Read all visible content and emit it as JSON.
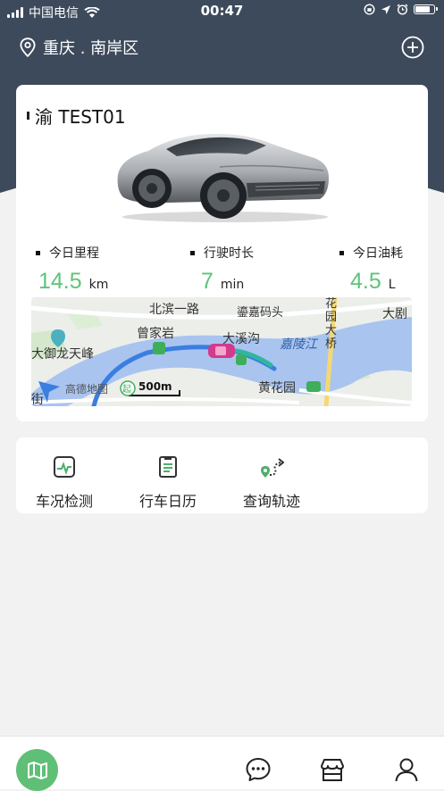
{
  "status_bar": {
    "carrier": "中国电信",
    "time": "00:47"
  },
  "location": {
    "city": "重庆 . 南岸区"
  },
  "vehicle": {
    "plate": "渝 TEST01"
  },
  "stats": [
    {
      "label": "今日里程",
      "value": "14.5",
      "unit": "km"
    },
    {
      "label": "行驶时长",
      "value": "7",
      "unit": "min"
    },
    {
      "label": "今日油耗",
      "value": "4.5",
      "unit": "L"
    }
  ],
  "map": {
    "labels": {
      "beibin_road": "北滨一路",
      "luanjia": "鎏嘉码头",
      "bridge": "花园大桥",
      "daju": "大剧",
      "zengjiayan": "曾家岩",
      "daxigou": "大溪沟",
      "jialingjiang": "嘉陵江",
      "dayu": "大御龙天峰",
      "huanghuayuan": "黄花园",
      "jie": "街",
      "amap": "高德地图",
      "start": "起",
      "scale": "500m"
    }
  },
  "functions": [
    {
      "label": "车况检测",
      "icon": "pulse-monitor-icon"
    },
    {
      "label": "行车日历",
      "icon": "clipboard-list-icon"
    },
    {
      "label": "查询轨迹",
      "icon": "route-track-icon"
    }
  ],
  "tabbar": {
    "items": [
      "map-icon",
      "chat-bubble-icon",
      "store-icon",
      "user-icon"
    ]
  },
  "colors": {
    "header": "#3d4a5c",
    "accent": "#5fc37a",
    "background": "#f2f2f2"
  }
}
